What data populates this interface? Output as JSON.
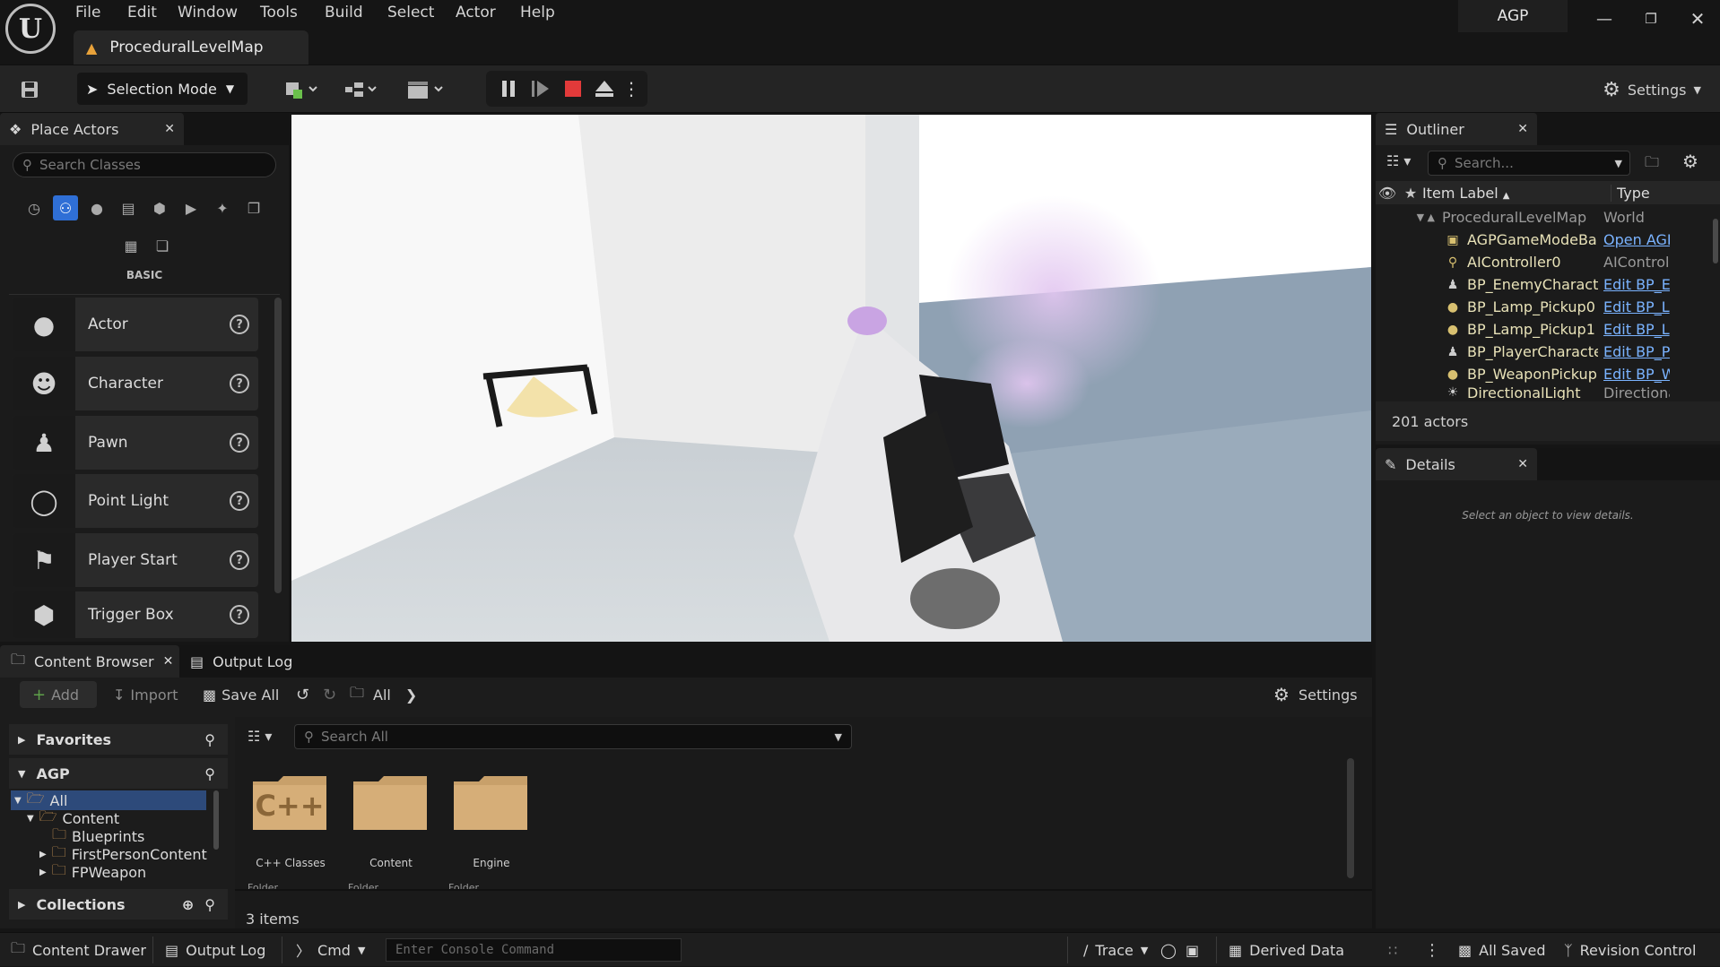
{
  "menu": [
    "File",
    "Edit",
    "Window",
    "Tools",
    "Build",
    "Select",
    "Actor",
    "Help"
  ],
  "project_name": "AGP",
  "map_tab": "ProceduralLevelMap",
  "toolbar": {
    "selection_mode": "Selection Mode",
    "settings": "Settings"
  },
  "place_actors": {
    "tab": "Place Actors",
    "search_placeholder": "Search Classes",
    "category_label": "BASIC",
    "items": [
      {
        "label": "Actor",
        "icon": "sphere-icon"
      },
      {
        "label": "Character",
        "icon": "character-icon"
      },
      {
        "label": "Pawn",
        "icon": "pawn-icon"
      },
      {
        "label": "Point Light",
        "icon": "bulb-icon"
      },
      {
        "label": "Player Start",
        "icon": "flag-icon"
      },
      {
        "label": "Trigger Box",
        "icon": "box-icon"
      }
    ]
  },
  "outliner": {
    "tab": "Outliner",
    "search_placeholder": "Search...",
    "col_label": "Item Label",
    "col_type": "Type",
    "rows": [
      {
        "label": "ProceduralLevelMap",
        "type": "World",
        "type_link": false,
        "dim": true
      },
      {
        "label": "AGPGameModeBa",
        "type": "Open AGF",
        "type_link": true,
        "dim": false
      },
      {
        "label": "AIController0",
        "type": "AIControll",
        "type_link": false,
        "dim": false
      },
      {
        "label": "BP_EnemyCharacte",
        "type": "Edit BP_E",
        "type_link": true,
        "dim": false
      },
      {
        "label": "BP_Lamp_Pickup0",
        "type": "Edit BP_L",
        "type_link": true,
        "dim": false
      },
      {
        "label": "BP_Lamp_Pickup1",
        "type": "Edit BP_L",
        "type_link": true,
        "dim": false
      },
      {
        "label": "BP_PlayerCharacte",
        "type": "Edit BP_P",
        "type_link": true,
        "dim": false
      },
      {
        "label": "BP_WeaponPickup",
        "type": "Edit BP_W",
        "type_link": true,
        "dim": false
      },
      {
        "label": "DirectionalLight",
        "type": "Directiona",
        "type_link": false,
        "dim": false
      }
    ],
    "count": "201 actors"
  },
  "details": {
    "tab": "Details",
    "empty": "Select an object to view details."
  },
  "content_browser": {
    "tab": "Content Browser",
    "tab2": "Output Log",
    "add": "Add",
    "import": "Import",
    "save_all": "Save All",
    "path": "All",
    "settings": "Settings",
    "favorites": "Favorites",
    "project": "AGP",
    "tree": [
      "All",
      "Content",
      "Blueprints",
      "FirstPersonContent",
      "FPWeapon"
    ],
    "collections": "Collections",
    "search_placeholder": "Search All",
    "folders": [
      {
        "name": "C++ Classes",
        "kind": "Folder",
        "badge": "C++"
      },
      {
        "name": "Content",
        "kind": "Folder",
        "badge": ""
      },
      {
        "name": "Engine",
        "kind": "Folder",
        "badge": ""
      }
    ],
    "count": "3 items"
  },
  "statusbar": {
    "content_drawer": "Content Drawer",
    "output_log": "Output Log",
    "cmd": "Cmd",
    "console_placeholder": "Enter Console Command",
    "trace": "Trace",
    "derived_data": "Derived Data",
    "all_saved": "All Saved",
    "revision_control": "Revision Control"
  }
}
